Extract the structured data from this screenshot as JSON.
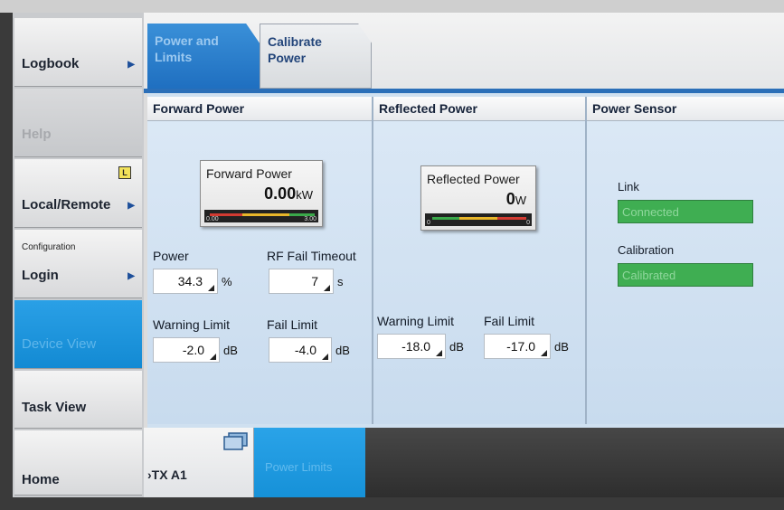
{
  "sidebar": {
    "items": [
      {
        "label": "Logbook"
      },
      {
        "label": "Help"
      },
      {
        "label": "Local/Remote",
        "badge": "L"
      },
      {
        "caption": "Configuration",
        "label": "Login"
      },
      {
        "label": "Device View"
      },
      {
        "label": "Task View"
      },
      {
        "label": "Home"
      }
    ]
  },
  "tabs": [
    {
      "label_line1": "Power and",
      "label_line2": "Limits"
    },
    {
      "label_line1": "Calibrate",
      "label_line2": "Power"
    }
  ],
  "forward": {
    "header": "Forward Power",
    "meter": {
      "title": "Forward Power",
      "value": "0.00",
      "unit": "kW",
      "scale_min": "0.00",
      "scale_max": "3.00"
    },
    "power": {
      "label": "Power",
      "value": "34.3",
      "unit": "%"
    },
    "rf_fail_timeout": {
      "label": "RF Fail Timeout",
      "value": "7",
      "unit": "s"
    },
    "warning_limit": {
      "label": "Warning Limit",
      "value": "-2.0",
      "unit": "dB"
    },
    "fail_limit": {
      "label": "Fail  Limit",
      "value": "-4.0",
      "unit": "dB"
    }
  },
  "reflected": {
    "header": "Reflected Power",
    "meter": {
      "title": "Reflected Power",
      "value": "0",
      "unit": "W",
      "scale_min": "0",
      "scale_max": "0"
    },
    "warning_limit": {
      "label": "Warning Limit",
      "value": "-18.0",
      "unit": "dB"
    },
    "fail_limit": {
      "label": "Fail Limit",
      "value": "-17.0",
      "unit": "dB"
    }
  },
  "sensor": {
    "header": "Power Sensor",
    "link": {
      "label": "Link",
      "value": "Connected"
    },
    "calibration": {
      "label": "Calibration",
      "value": "Calibrated"
    }
  },
  "breadcrumb": {
    "items": [
      {
        "label": "TX A1"
      },
      {
        "label": "Power Limits"
      }
    ]
  },
  "colors": {
    "accent_blue": "#1f6fc0",
    "status_green": "#3fae52"
  }
}
